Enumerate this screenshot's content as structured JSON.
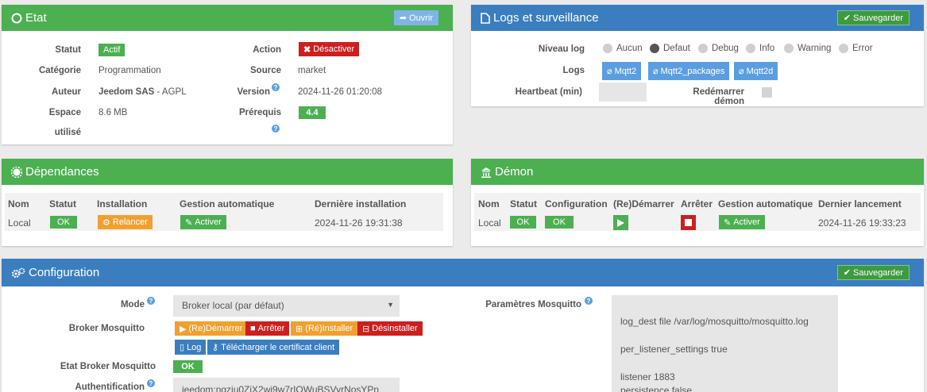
{
  "etat": {
    "title": "Etat",
    "open_label": "Ouvrir",
    "statut_label": "Statut",
    "statut_value": "Actif",
    "action_label": "Action",
    "action_button": "Désactiver",
    "categorie_label": "Catégorie",
    "categorie_value": "Programmation",
    "source_label": "Source",
    "source_value": "market",
    "auteur_label": "Auteur",
    "auteur_value": "Jeedom SAS",
    "license_value": "AGPL",
    "version_label": "Version",
    "version_value": "2024-11-26 01:20:08",
    "espace_label_1": "Espace",
    "espace_label_2": "utilisé",
    "espace_value": "8.6 MB",
    "prerequis_label": "Prérequis",
    "prerequis_value": "4.4"
  },
  "logs": {
    "title": "Logs et surveillance",
    "save_label": "Sauvegarder",
    "niveau_label": "Niveau log",
    "levels": [
      "Aucun",
      "Defaut",
      "Debug",
      "Info",
      "Warning",
      "Error"
    ],
    "selected_level": "Defaut",
    "logs_label": "Logs",
    "log_buttons": [
      "Mqtt2",
      "Mqtt2_packages",
      "Mqtt2d"
    ],
    "heartbeat_label": "Heartbeat (min)",
    "heartbeat_value": "",
    "restart_label": "Redémarrer démon"
  },
  "dependances": {
    "title": "Dépendances",
    "headers": [
      "Nom",
      "Statut",
      "Installation",
      "Gestion automatique",
      "Dernière installation"
    ],
    "row": {
      "nom": "Local",
      "statut": "OK",
      "installation": "Relancer",
      "gestion": "Activer",
      "derniere": "2024-11-26 19:31:38"
    }
  },
  "demon": {
    "title": "Démon",
    "headers": [
      "Nom",
      "Statut",
      "Configuration",
      "(Re)Démarrer",
      "Arrêter",
      "Gestion automatique",
      "Dernier lancement"
    ],
    "row": {
      "nom": "Local",
      "statut": "OK",
      "configuration": "OK",
      "gestion": "Activer",
      "dernier": "2024-11-26 19:33:23"
    }
  },
  "configuration": {
    "title": "Configuration",
    "save_label": "Sauvegarder",
    "mode_label": "Mode",
    "mode_value": "Broker local (par défaut)",
    "broker_label": "Broker Mosquitto",
    "broker_buttons": {
      "restart": "(Re)Démarrer",
      "stop": "Arrêter",
      "install": "(Ré)Installer",
      "uninstall": "Désinstaller",
      "log": "Log",
      "cert": "Télécharger le certificat client"
    },
    "etat_broker_label": "Etat Broker Mosquitto",
    "etat_broker_value": "OK",
    "auth_label": "Authentification",
    "auth_value": "jeedom:ngziu0ZiX2wi9w7rIOWuBSVyrNosYPn",
    "params_label": "Paramètres Mosquitto",
    "params_lines": [
      "log_dest file /var/log/mosquitto/mosquitto.log",
      "per_listener_settings true",
      "listener 1883",
      "persistence false"
    ]
  },
  "colors": {
    "green": "#4caf50",
    "blue": "#3a7ebf",
    "red": "#cc1f1f",
    "orange": "#f0a030"
  }
}
